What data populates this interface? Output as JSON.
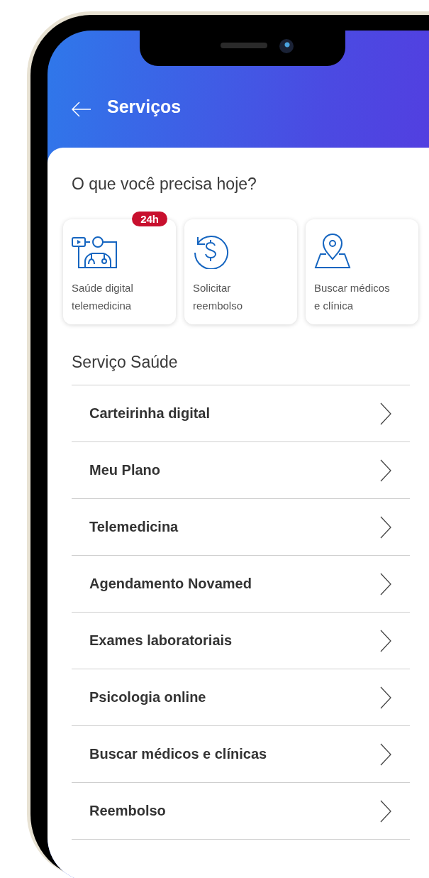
{
  "header": {
    "title": "Serviços"
  },
  "quick_actions": {
    "title": "O que você precisa hoje?",
    "items": [
      {
        "kind": "telemedicine",
        "label": "Saúde digital\ntelemedicina",
        "badge": "24h"
      },
      {
        "kind": "refund",
        "label": "Solicitar\nreembolso"
      },
      {
        "kind": "location",
        "label": "Buscar médicos\ne clínica"
      }
    ]
  },
  "services": {
    "title": "Serviço Saúde",
    "items": [
      "Carteirinha digital",
      "Meu Plano",
      "Telemedicina",
      "Agendamento Novamed",
      "Exames laboratoriais",
      "Psicologia online",
      "Buscar médicos e clínicas",
      "Reembolso"
    ]
  }
}
